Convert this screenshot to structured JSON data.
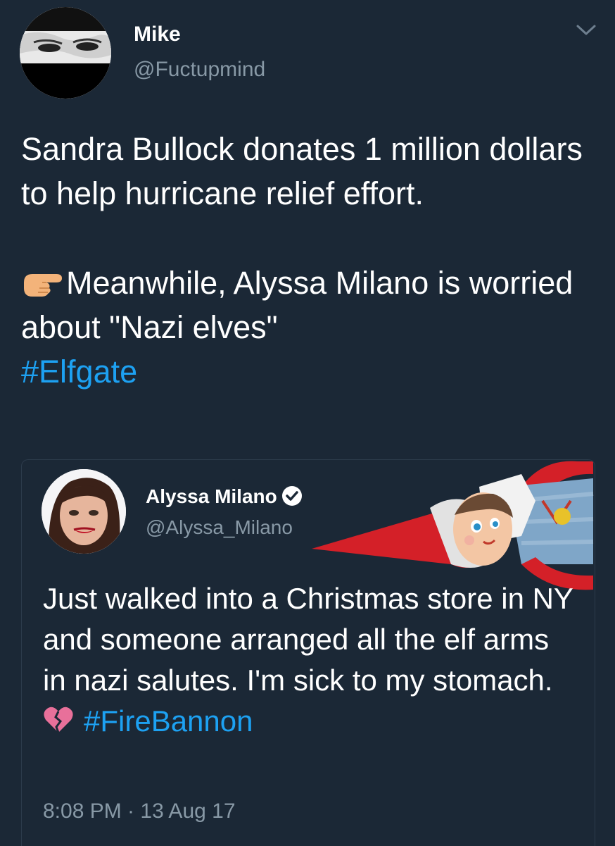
{
  "tweet": {
    "author_name": "Mike",
    "author_handle": "@Fuctupmind",
    "text_line1": "Sandra Bullock donates 1 million dollars to help hurricane relief effort.",
    "text_line2": "Meanwhile, Alyssa Milano is worried about \"Nazi elves\"",
    "hashtag": "#Elfgate",
    "emoji": "pointing-right-hand-icon",
    "menu_icon": "chevron-down-icon"
  },
  "quote": {
    "author_name": "Alyssa Milano",
    "author_handle": "@Alyssa_Milano",
    "verified_icon": "verified-badge-icon",
    "text": "Just walked into a Christmas store in NY and someone arranged all the elf arms in nazi salutes. I'm sick to my stomach.",
    "emoji": "broken-heart-icon",
    "hashtag": "#FireBannon",
    "timestamp": "8:08 PM · 13 Aug 17"
  },
  "colors": {
    "background": "#1b2836",
    "text": "#ffffff",
    "secondary_text": "#8899a6",
    "hashtag": "#1da1f2",
    "quote_border": "#2c3b4b"
  }
}
